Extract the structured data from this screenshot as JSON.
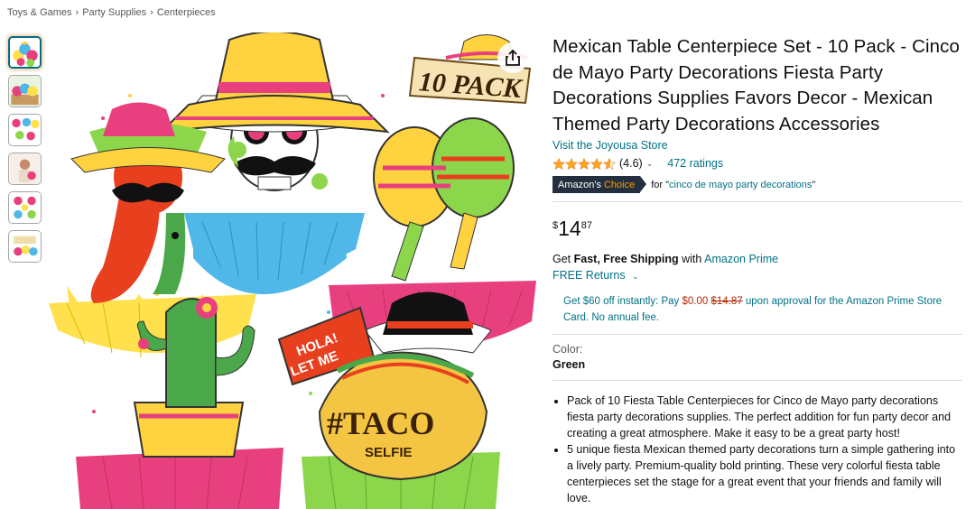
{
  "breadcrumb": [
    "Toys & Games",
    "Party Supplies",
    "Centerpieces"
  ],
  "product": {
    "title": "Mexican Table Centerpiece Set - 10 Pack - Cinco de Mayo Party Decorations Fiesta Party Decorations Supplies Favors Decor - Mexican Themed Party Decorations Accessories",
    "store_link": "Visit the Joyousa Store",
    "rating": "(4.6)",
    "ratings_count": "472 ratings",
    "badge_prefix": "Amazon's",
    "badge_choice": "Choice",
    "choice_for": "for \"",
    "choice_term": "cinco de mayo party decorations",
    "choice_close": "\"",
    "price_symbol": "$",
    "price_whole": "14",
    "price_fraction": "87",
    "shipping_get": "Get ",
    "shipping_bold": "Fast, Free Shipping",
    "shipping_with": " with ",
    "shipping_prime": "Amazon Prime",
    "free_returns": "FREE Returns",
    "offer_pre": "Get $60 off instantly: Pay ",
    "offer_pay": "$0.00",
    "offer_space": " ",
    "offer_strike": "$14.87",
    "offer_post": " upon approval for the Amazon Prime Store Card. No annual fee.",
    "color_label": "Color:",
    "color_value": "Green",
    "bullets": [
      "Pack of 10 Fiesta Table Centerpieces for Cinco de Mayo party decorations fiesta party decorations supplies. The perfect addition for fun party decor and creating a great atmosphere. Make it easy to be a great party host!",
      "5 unique fiesta Mexican themed party decorations turn a simple gathering into a lively party. Premium-quality bold printing. These very colorful fiesta table centerpieces set the stage for a great event that your friends and family will love."
    ]
  },
  "image_text": {
    "pack": "10 PACK",
    "hola": "HOLA!",
    "let_me": "LET ME",
    "taco": "#TACO",
    "selfie": "SELFIE"
  },
  "colors": {
    "link": "#007185",
    "price_red": "#b12704",
    "badge_bg": "#232f3e",
    "badge_accent": "#ff9900",
    "star": "#ffa41c"
  },
  "icons": {
    "share": "share-icon",
    "star": "star-icon",
    "chevron": "chevron-down-icon"
  }
}
